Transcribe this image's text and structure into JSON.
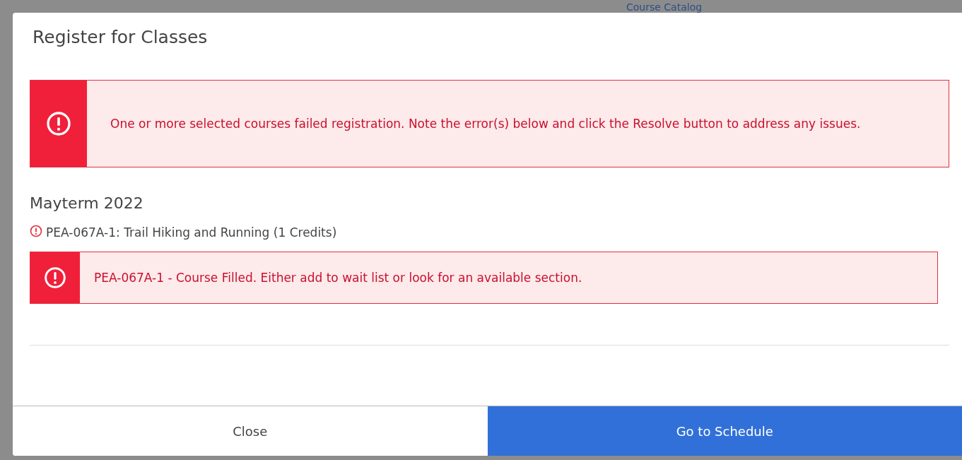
{
  "backdrop": {
    "link": "Course Catalog"
  },
  "dialog": {
    "title": "Register for Classes",
    "alert": {
      "message": "One or more selected courses failed registration. Note the error(s) below and click the Resolve button to address any issues."
    },
    "term": "Mayterm 2022",
    "courses": [
      {
        "label": "PEA-067A-1: Trail Hiking and Running (1 Credits)",
        "failed": true,
        "error": "PEA-067A-1 - Course Filled. Either add to wait list or look for an available section."
      }
    ],
    "buttons": [
      {
        "label": "Close",
        "kind": "secondary"
      },
      {
        "label": "Go to Schedule",
        "kind": "primary"
      }
    ]
  }
}
